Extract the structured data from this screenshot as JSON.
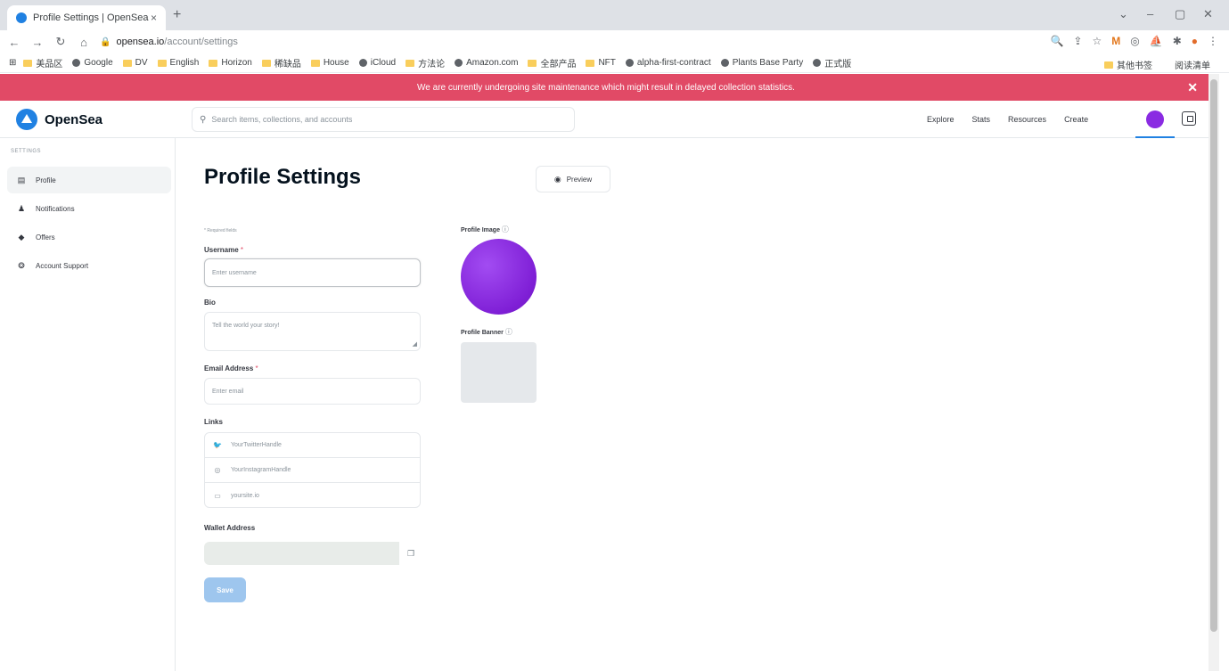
{
  "browser": {
    "tab_title": "Profile Settings | OpenSea",
    "tab_close": "×",
    "new_tab": "+",
    "url_host": "opensea.io",
    "url_path": "/account/settings",
    "window_controls": [
      "⌄",
      "–",
      "▢",
      "✕"
    ],
    "bookmarks": [
      "美品区",
      "Google",
      "DV",
      "English",
      "Horizon",
      "稀缺品",
      "House",
      "iCloud",
      "方法论",
      "Amazon.com",
      "全部产品",
      "NFT",
      "alpha-first-contract",
      "Plants Base Party",
      "正式版"
    ],
    "bookmarks_right": [
      "其他书签",
      "阅读清单"
    ]
  },
  "banner": {
    "message": "We are currently undergoing site maintenance which might result in delayed collection statistics.",
    "close": "✕"
  },
  "nav": {
    "brand": "OpenSea",
    "search_placeholder": "Search items, collections, and accounts",
    "links": [
      "Explore",
      "Stats",
      "Resources",
      "Create"
    ]
  },
  "sidebar": {
    "section_label": "SETTINGS",
    "items": [
      {
        "label": "Profile",
        "icon": "profile-icon"
      },
      {
        "label": "Notifications",
        "icon": "bell-icon"
      },
      {
        "label": "Offers",
        "icon": "tag-icon"
      },
      {
        "label": "Account Support",
        "icon": "help-icon"
      }
    ]
  },
  "main": {
    "title": "Profile Settings",
    "preview_label": "Preview",
    "required_note": "* Required fields",
    "username_label": "Username",
    "username_placeholder": "Enter username",
    "bio_label": "Bio",
    "bio_placeholder": "Tell the world your story!",
    "email_label": "Email Address",
    "email_placeholder": "Enter email",
    "links_label": "Links",
    "links": [
      {
        "placeholder": "YourTwitterHandle",
        "icon": "twitter-icon"
      },
      {
        "placeholder": "YourInstagramHandle",
        "icon": "instagram-icon"
      },
      {
        "placeholder": "yoursite.io",
        "icon": "website-icon"
      }
    ],
    "wallet_label": "Wallet Address",
    "wallet_value": "",
    "save_label": "Save",
    "profile_image_label": "Profile Image",
    "profile_banner_label": "Profile Banner"
  },
  "colors": {
    "banner": "#e14a66",
    "brand_blue": "#2081e2",
    "avatar_purple": "#8a2be2",
    "save_disabled": "#9ec6ee"
  }
}
